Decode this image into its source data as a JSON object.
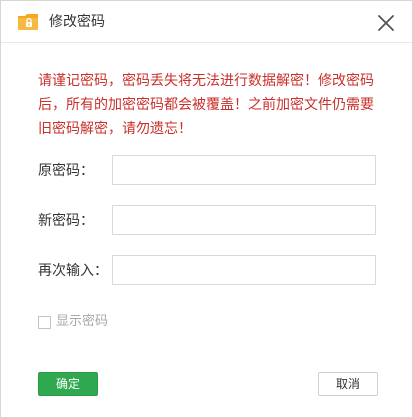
{
  "window": {
    "title": "修改密码",
    "app_icon": "folder-lock-icon",
    "close_icon": "close-icon"
  },
  "warning": {
    "text": "请谨记密码，密码丢失将无法进行数据解密！修改密码后，所有的加密密码都会被覆盖！之前加密文件仍需要旧密码解密，请勿遗忘！",
    "color": "#c9302c"
  },
  "fields": {
    "original": {
      "label": "原密码：",
      "value": ""
    },
    "new": {
      "label": "新密码：",
      "value": ""
    },
    "confirm": {
      "label": "再次输入：",
      "value": ""
    }
  },
  "show_password": {
    "label": "显示密码",
    "checked": false
  },
  "buttons": {
    "ok": "确定",
    "cancel": "取消"
  },
  "colors": {
    "primary_button": "#2fa84f",
    "icon_folder": "#f5a623"
  }
}
